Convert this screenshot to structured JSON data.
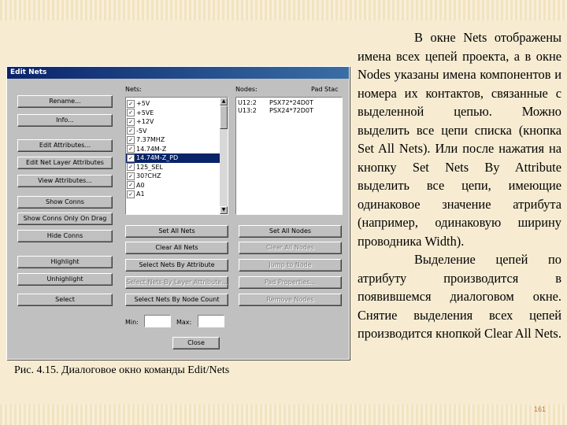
{
  "dialog": {
    "title": "Edit Nets",
    "nets_label": "Nets:",
    "nodes_label": "Nodes:",
    "pad_stacks_label": "Pad Stac",
    "left_buttons": [
      "Rename...",
      "Info...",
      "Edit Attributes...",
      "Edit Net Layer Attributes",
      "View Attributes...",
      "Show Conns",
      "Show Conns Only On Drag",
      "Hide Conns",
      "Highlight",
      "Unhighlight",
      "Select"
    ],
    "nets": [
      {
        "name": "+5V",
        "checked": true,
        "selected": false
      },
      {
        "name": "+5VE",
        "checked": true,
        "selected": false
      },
      {
        "name": "+12V",
        "checked": true,
        "selected": false
      },
      {
        "name": "-5V",
        "checked": true,
        "selected": false
      },
      {
        "name": "7.37MHZ",
        "checked": true,
        "selected": false
      },
      {
        "name": "14.74M-Z",
        "checked": true,
        "selected": false
      },
      {
        "name": "14.74M-Z_PD",
        "checked": true,
        "selected": true
      },
      {
        "name": "125_SEL",
        "checked": true,
        "selected": false
      },
      {
        "name": "30?CHZ",
        "checked": true,
        "selected": false
      },
      {
        "name": "A0",
        "checked": true,
        "selected": false
      },
      {
        "name": "A1",
        "checked": true,
        "selected": false
      }
    ],
    "nodes": [
      {
        "ref": "U12:2",
        "pad": "PSX72*24D0T"
      },
      {
        "ref": "U13:2",
        "pad": "PSX24*72D0T"
      }
    ],
    "nets_buttons": [
      "Set All Nets",
      "Clear All Nets",
      "Select Nets By Attribute",
      "Select Nets By Layer Attribute...",
      "Select Nets By Node Count"
    ],
    "nodes_buttons": [
      {
        "label": "Set All Nodes",
        "enabled": true
      },
      {
        "label": "Clear All Nodes",
        "enabled": false
      },
      {
        "label": "Jump to Node",
        "enabled": false
      },
      {
        "label": "Pad Properties...",
        "enabled": false
      },
      {
        "label": "Remove Nodes",
        "enabled": false
      }
    ],
    "min_label": "Min:",
    "max_label": "Max:",
    "min_value": "",
    "max_value": "",
    "close_label": "Close"
  },
  "caption": "Рис. 4.15. Диалоговое окно команды Edit/Nets",
  "body_paragraphs": [
    "В окне Nets отображены имена всех цепей проекта, а в окне Nodes указаны имена компонентов и номера их контактов, связанные с выделенной цепью. Можно выделить все цепи списка (кнопка Set All Nets). Или после нажатия на кнопку Set Nets By Attribute выделить все цепи, имеющие одинаковое значение атрибута (например, одинаковую ширину проводника Width).",
    "Выделение цепей по атрибуту производится в появившемся диалоговом окне. Снятие выделения всех цепей производится кнопкой Clear All Nets."
  ],
  "page_number": "161",
  "colors": {
    "background": "#f7ecd2",
    "dialog_face": "#c0c0c0",
    "titlebar": "#0a246a",
    "selection": "#0a246a",
    "page_number": "#c07a3a"
  }
}
